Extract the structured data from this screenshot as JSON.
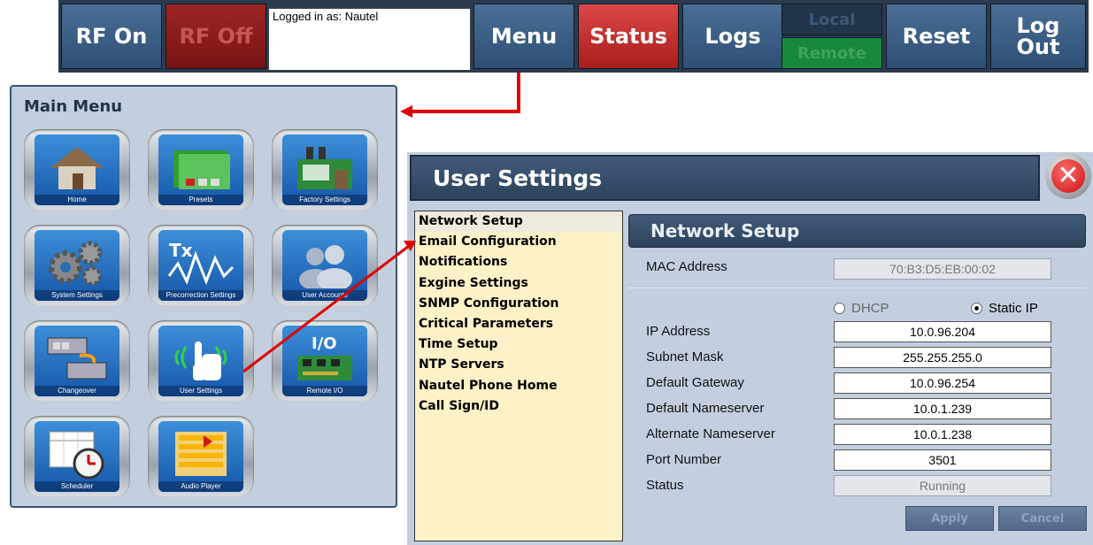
{
  "topbar": {
    "rf_on": "RF On",
    "rf_off": "RF Off",
    "logged_in": "Logged in as: Nautel",
    "menu": "Menu",
    "status": "Status",
    "logs": "Logs",
    "local": "Local",
    "remote": "Remote",
    "reset": "Reset",
    "logout_line1": "Log",
    "logout_line2": "Out"
  },
  "main_menu": {
    "title": "Main Menu",
    "tiles": [
      {
        "label": "Home",
        "icon": "house-icon"
      },
      {
        "label": "Presets",
        "icon": "folders-icon"
      },
      {
        "label": "Factory Settings",
        "icon": "factory-icon"
      },
      {
        "label": "System Settings",
        "icon": "gears-icon"
      },
      {
        "label": "Precorrection Settings",
        "icon": "waveform-icon",
        "glyph": "Tx"
      },
      {
        "label": "User Accounts",
        "icon": "users-icon"
      },
      {
        "label": "Changeover",
        "icon": "changeover-icon"
      },
      {
        "label": "User Settings",
        "icon": "hand-touch-icon"
      },
      {
        "label": "Remote I/O",
        "icon": "circuit-board-icon",
        "glyph": "I/O"
      },
      {
        "label": "Scheduler",
        "icon": "calendar-clock-icon"
      },
      {
        "label": "Audio Player",
        "icon": "playlist-icon"
      }
    ]
  },
  "user_settings": {
    "title": "User Settings",
    "menu": [
      "Network Setup",
      "Email Configuration",
      "Notifications",
      "Exgine Settings",
      "SNMP Configuration",
      "Critical Parameters",
      "Time Setup",
      "NTP Servers",
      "Nautel Phone Home",
      "Call Sign/ID"
    ],
    "network": {
      "title": "Network Setup",
      "mac_label": "MAC Address",
      "mac_value": "70:B3:D5:EB:00:02",
      "dhcp": "DHCP",
      "static_ip": "Static IP",
      "ip_label": "IP Address",
      "ip_value": "10.0.96.204",
      "subnet_label": "Subnet Mask",
      "subnet_value": "255.255.255.0",
      "gateway_label": "Default Gateway",
      "gateway_value": "10.0.96.254",
      "ns_label": "Default Nameserver",
      "ns_value": "10.0.1.239",
      "alt_ns_label": "Alternate Nameserver",
      "alt_ns_value": "10.0.1.238",
      "port_label": "Port Number",
      "port_value": "3501",
      "status_label": "Status",
      "status_value": "Running",
      "apply": "Apply",
      "cancel": "Cancel"
    }
  },
  "colors": {
    "blue_button": "#3d5f86",
    "red_button": "#c62828",
    "panel": "#c3cfde",
    "list_bg": "#fdf1c8",
    "arrow": "#e00000"
  }
}
